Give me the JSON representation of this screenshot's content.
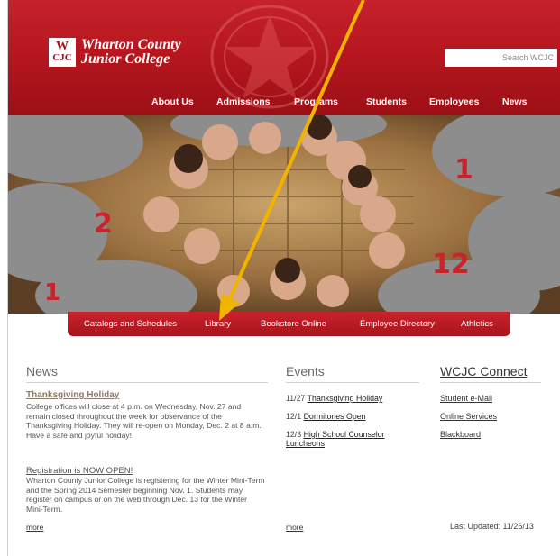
{
  "header": {
    "logo_mark": "WCJC",
    "logo_line1": "Wharton County",
    "logo_line2": "Junior College",
    "search_placeholder": "Search WCJC"
  },
  "nav": {
    "items": [
      "About Us",
      "Admissions",
      "Programs",
      "Students",
      "Employees",
      "News"
    ]
  },
  "quick_links": [
    "Catalogs and Schedules",
    "Library",
    "Bookstore Online",
    "Employee Directory",
    "Athletics"
  ],
  "news": {
    "title": "News",
    "items": [
      {
        "headline": "Thanksgiving Holiday",
        "body": "College offices will close at 4 p.m. on Wednesday, Nov. 27 and remain closed throughout the week for observance of the Thanksgiving Holiday. They will re-open on Monday, Dec. 2 at 8 a.m.  Have a safe and joyful holiday!"
      },
      {
        "headline": "Registration is NOW OPEN!",
        "body": "Wharton County Junior College is registering for the Winter Mini-Term and the Spring 2014 Semester beginning Nov. 1. Students may register on campus or on the web through Dec. 13 for the Winter Mini-Term."
      }
    ],
    "more": "more"
  },
  "events": {
    "title": "Events",
    "items": [
      {
        "date": "11/27",
        "label": "Thanksgiving Holiday"
      },
      {
        "date": "12/1",
        "label": "Dormitories Open"
      },
      {
        "date": "12/3",
        "label": "High School Counselor Luncheons"
      }
    ],
    "more": "more"
  },
  "connect": {
    "title": "WCJC Connect",
    "items": [
      "Student e-Mail",
      "Online Services",
      "Blackboard"
    ],
    "last_updated": "Last Updated: 11/26/13"
  },
  "colors": {
    "header_red": "#b3151d",
    "annotation_arrow": "#f2b300"
  }
}
